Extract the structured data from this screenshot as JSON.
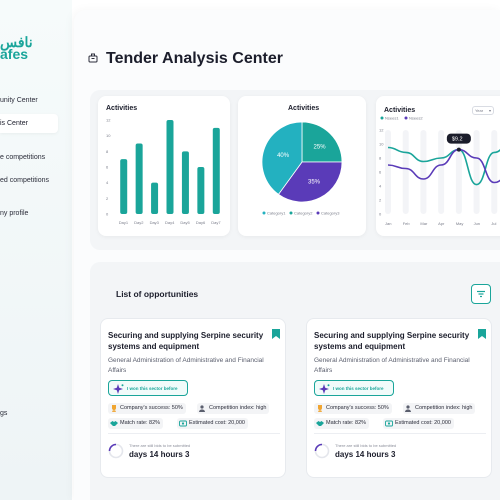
{
  "brand": {
    "logo_ar": "نافس",
    "logo_en": "afes",
    "accent": "#1aa59a",
    "purple": "#5a3bb8"
  },
  "sidebar": {
    "items": [
      {
        "label": "unity Center"
      },
      {
        "label": "is Center"
      },
      {
        "label": "e competitions"
      },
      {
        "label": "ed competitions"
      },
      {
        "label": "ny profile"
      },
      {
        "label": "gs"
      }
    ]
  },
  "page": {
    "title": "Tender Analysis Center"
  },
  "charts": {
    "bar": {
      "title": "Activities"
    },
    "pie": {
      "title": "Activities"
    },
    "line": {
      "title": "Activities",
      "select": "Year",
      "tooltip": "$9.2"
    }
  },
  "chart_data": [
    {
      "type": "bar",
      "title": "Activities",
      "categories": [
        "Day1",
        "Day2",
        "Day3",
        "Day4",
        "Day5",
        "Day6",
        "Day7"
      ],
      "values": [
        7,
        9,
        4,
        12,
        8,
        6,
        11
      ],
      "y_ticks": [
        "0",
        "2",
        "4",
        "6",
        "8",
        "10",
        "12"
      ],
      "ylim": [
        0,
        12
      ],
      "color": "#1aa59a"
    },
    {
      "type": "pie",
      "title": "Activities",
      "slices": [
        {
          "name": "Category1",
          "value": 40,
          "label": "40%",
          "color": "#23b1c0"
        },
        {
          "name": "Category2",
          "value": 25,
          "label": "25%",
          "color": "#1aa59a"
        },
        {
          "name": "Category3",
          "value": 35,
          "label": "35%",
          "color": "#5a3bb8"
        }
      ]
    },
    {
      "type": "line",
      "title": "Activities",
      "x": [
        "Jan",
        "Feb",
        "Mar",
        "Apr",
        "May",
        "Jun",
        "Jul"
      ],
      "y_ticks": [
        "0",
        "2",
        "4",
        "6",
        "8",
        "10",
        "12"
      ],
      "ylim": [
        0,
        12
      ],
      "series": [
        {
          "name": "Nsees1",
          "color": "#1aa59a",
          "values": [
            9.5,
            8.8,
            7.5,
            8.0,
            9.2,
            4.2,
            8.8,
            10.5
          ]
        },
        {
          "name": "Nsees2",
          "color": "#5a3bb8",
          "values": [
            7.0,
            6.5,
            5.0,
            7.0,
            9.2,
            8.0,
            4.5,
            6.0
          ]
        }
      ]
    }
  ],
  "opportunities": {
    "title": "List of opportunities",
    "cards": [
      {
        "name": "Securing and supplying Serpine security systems and equipment",
        "org": "General Administration of Administrative and Financial Affairs",
        "badge": "I won this sector before",
        "success": "Company's success: 50%",
        "competition": "Competition index: high",
        "match": "Match rate: 82%",
        "cost": "Estimated cost: 20,000",
        "remaining_label": "There are still bids to be submitted",
        "remaining": "days 14 hours 3"
      },
      {
        "name": "Securing and supplying Serpine security systems and equipment",
        "org": "General Administration of Administrative and Financial Affairs",
        "badge": "I won this sector before",
        "success": "Company's success: 50%",
        "competition": "Competition index: high",
        "match": "Match rate: 82%",
        "cost": "Estimated cost: 20,000",
        "remaining_label": "There are still bids to be submitted",
        "remaining": "days 14 hours 3"
      }
    ]
  }
}
